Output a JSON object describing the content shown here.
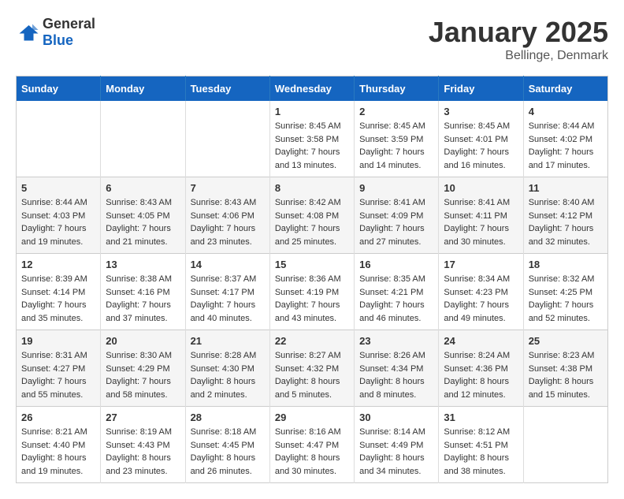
{
  "header": {
    "logo_general": "General",
    "logo_blue": "Blue",
    "title": "January 2025",
    "subtitle": "Bellinge, Denmark"
  },
  "days_of_week": [
    "Sunday",
    "Monday",
    "Tuesday",
    "Wednesday",
    "Thursday",
    "Friday",
    "Saturday"
  ],
  "weeks": [
    [
      {
        "day": "",
        "info": ""
      },
      {
        "day": "",
        "info": ""
      },
      {
        "day": "",
        "info": ""
      },
      {
        "day": "1",
        "info": "Sunrise: 8:45 AM\nSunset: 3:58 PM\nDaylight: 7 hours\nand 13 minutes."
      },
      {
        "day": "2",
        "info": "Sunrise: 8:45 AM\nSunset: 3:59 PM\nDaylight: 7 hours\nand 14 minutes."
      },
      {
        "day": "3",
        "info": "Sunrise: 8:45 AM\nSunset: 4:01 PM\nDaylight: 7 hours\nand 16 minutes."
      },
      {
        "day": "4",
        "info": "Sunrise: 8:44 AM\nSunset: 4:02 PM\nDaylight: 7 hours\nand 17 minutes."
      }
    ],
    [
      {
        "day": "5",
        "info": "Sunrise: 8:44 AM\nSunset: 4:03 PM\nDaylight: 7 hours\nand 19 minutes."
      },
      {
        "day": "6",
        "info": "Sunrise: 8:43 AM\nSunset: 4:05 PM\nDaylight: 7 hours\nand 21 minutes."
      },
      {
        "day": "7",
        "info": "Sunrise: 8:43 AM\nSunset: 4:06 PM\nDaylight: 7 hours\nand 23 minutes."
      },
      {
        "day": "8",
        "info": "Sunrise: 8:42 AM\nSunset: 4:08 PM\nDaylight: 7 hours\nand 25 minutes."
      },
      {
        "day": "9",
        "info": "Sunrise: 8:41 AM\nSunset: 4:09 PM\nDaylight: 7 hours\nand 27 minutes."
      },
      {
        "day": "10",
        "info": "Sunrise: 8:41 AM\nSunset: 4:11 PM\nDaylight: 7 hours\nand 30 minutes."
      },
      {
        "day": "11",
        "info": "Sunrise: 8:40 AM\nSunset: 4:12 PM\nDaylight: 7 hours\nand 32 minutes."
      }
    ],
    [
      {
        "day": "12",
        "info": "Sunrise: 8:39 AM\nSunset: 4:14 PM\nDaylight: 7 hours\nand 35 minutes."
      },
      {
        "day": "13",
        "info": "Sunrise: 8:38 AM\nSunset: 4:16 PM\nDaylight: 7 hours\nand 37 minutes."
      },
      {
        "day": "14",
        "info": "Sunrise: 8:37 AM\nSunset: 4:17 PM\nDaylight: 7 hours\nand 40 minutes."
      },
      {
        "day": "15",
        "info": "Sunrise: 8:36 AM\nSunset: 4:19 PM\nDaylight: 7 hours\nand 43 minutes."
      },
      {
        "day": "16",
        "info": "Sunrise: 8:35 AM\nSunset: 4:21 PM\nDaylight: 7 hours\nand 46 minutes."
      },
      {
        "day": "17",
        "info": "Sunrise: 8:34 AM\nSunset: 4:23 PM\nDaylight: 7 hours\nand 49 minutes."
      },
      {
        "day": "18",
        "info": "Sunrise: 8:32 AM\nSunset: 4:25 PM\nDaylight: 7 hours\nand 52 minutes."
      }
    ],
    [
      {
        "day": "19",
        "info": "Sunrise: 8:31 AM\nSunset: 4:27 PM\nDaylight: 7 hours\nand 55 minutes."
      },
      {
        "day": "20",
        "info": "Sunrise: 8:30 AM\nSunset: 4:29 PM\nDaylight: 7 hours\nand 58 minutes."
      },
      {
        "day": "21",
        "info": "Sunrise: 8:28 AM\nSunset: 4:30 PM\nDaylight: 8 hours\nand 2 minutes."
      },
      {
        "day": "22",
        "info": "Sunrise: 8:27 AM\nSunset: 4:32 PM\nDaylight: 8 hours\nand 5 minutes."
      },
      {
        "day": "23",
        "info": "Sunrise: 8:26 AM\nSunset: 4:34 PM\nDaylight: 8 hours\nand 8 minutes."
      },
      {
        "day": "24",
        "info": "Sunrise: 8:24 AM\nSunset: 4:36 PM\nDaylight: 8 hours\nand 12 minutes."
      },
      {
        "day": "25",
        "info": "Sunrise: 8:23 AM\nSunset: 4:38 PM\nDaylight: 8 hours\nand 15 minutes."
      }
    ],
    [
      {
        "day": "26",
        "info": "Sunrise: 8:21 AM\nSunset: 4:40 PM\nDaylight: 8 hours\nand 19 minutes."
      },
      {
        "day": "27",
        "info": "Sunrise: 8:19 AM\nSunset: 4:43 PM\nDaylight: 8 hours\nand 23 minutes."
      },
      {
        "day": "28",
        "info": "Sunrise: 8:18 AM\nSunset: 4:45 PM\nDaylight: 8 hours\nand 26 minutes."
      },
      {
        "day": "29",
        "info": "Sunrise: 8:16 AM\nSunset: 4:47 PM\nDaylight: 8 hours\nand 30 minutes."
      },
      {
        "day": "30",
        "info": "Sunrise: 8:14 AM\nSunset: 4:49 PM\nDaylight: 8 hours\nand 34 minutes."
      },
      {
        "day": "31",
        "info": "Sunrise: 8:12 AM\nSunset: 4:51 PM\nDaylight: 8 hours\nand 38 minutes."
      },
      {
        "day": "",
        "info": ""
      }
    ]
  ]
}
